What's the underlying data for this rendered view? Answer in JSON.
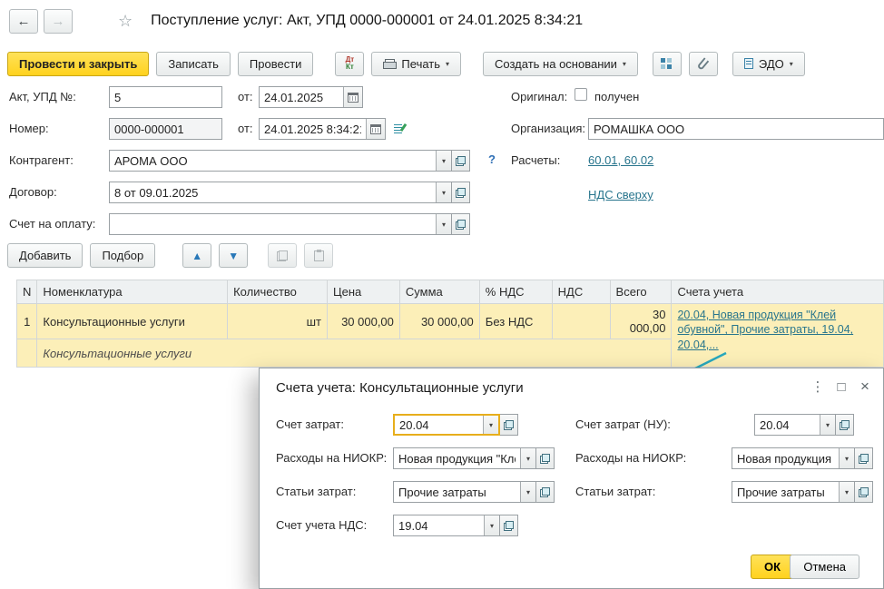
{
  "icons": {
    "back": "←",
    "forward": "→",
    "star": "☆",
    "caret": "▾",
    "up": "▲",
    "down": "▼",
    "menu": "⋮",
    "maximize": "□",
    "close": "×"
  },
  "colors": {
    "accent_yellow": "#ffd21e",
    "link_teal": "#28758d",
    "row_highlight": "#fcefb8",
    "focus_border": "#e7ae1c",
    "callout_arrow": "#29a8bd"
  },
  "titlebar": {
    "title": "Поступление услуг: Акт, УПД 0000-000001 от 24.01.2025 8:34:21"
  },
  "toolbar": {
    "post_and_close": "Провести и закрыть",
    "write": "Записать",
    "post": "Провести",
    "dtkt_dt": "Дт",
    "dtkt_kt": "Кт",
    "print": "Печать",
    "create_on_basis": "Создать на основании",
    "edo": "ЭДО"
  },
  "form": {
    "left": {
      "act_label": "Акт, УПД №:",
      "act_number": "5",
      "act_from_label": "от:",
      "act_date": "24.01.2025",
      "number_label": "Номер:",
      "number_value": "0000-000001",
      "number_from_label": "от:",
      "number_datetime": "24.01.2025 8:34:21",
      "counterparty_label": "Контрагент:",
      "counterparty_value": "АРОМА ООО",
      "help_link": "?",
      "contract_label": "Договор:",
      "contract_value": "8 от 09.01.2025",
      "invoice_label": "Счет на оплату:",
      "invoice_value": ""
    },
    "right": {
      "original_label": "Оригинал:",
      "original_checkbox_label": "получен",
      "organization_label": "Организация:",
      "organization_value": "РОМАШКА ООО",
      "settlements_label": "Расчеты:",
      "settlements_link": "60.01, 60.02",
      "vat_link": "НДС сверху"
    }
  },
  "table_toolbar": {
    "add": "Добавить",
    "pick": "Подбор"
  },
  "table": {
    "headers": [
      "N",
      "Номенклатура",
      "Количество",
      "Цена",
      "Сумма",
      "% НДС",
      "НДС",
      "Всего",
      "Счета учета"
    ],
    "row": {
      "n": "1",
      "nomenclature": "Консультационные услуги",
      "unit": "шт",
      "price": "30 000,00",
      "amount": "30 000,00",
      "vat_rate": "Без НДС",
      "vat": "",
      "total": "30 000,00",
      "accounts_link": "20.04, Новая продукция \"Клей обувной\", Прочие затраты, 19.04, 20.04,...",
      "content": "Консультационные услуги"
    }
  },
  "dialog": {
    "title": "Счета учета: Консультационные услуги",
    "fields": {
      "cost_account_label": "Счет затрат:",
      "cost_account_value": "20.04",
      "cost_account_nu_label": "Счет затрат (НУ):",
      "cost_account_nu_value": "20.04",
      "rnd_left_label": "Расходы на НИОКР:",
      "rnd_left_value": "Новая продукция \"Кле",
      "rnd_right_label": "Расходы на НИОКР:",
      "rnd_right_value": "Новая продукция \"Кле",
      "cost_item_left_label": "Статьи затрат:",
      "cost_item_left_value": "Прочие затраты",
      "cost_item_right_label": "Статьи затрат:",
      "cost_item_right_value": "Прочие затраты",
      "vat_account_label": "Счет учета НДС:",
      "vat_account_value": "19.04"
    },
    "ok": "ОК",
    "cancel": "Отмена"
  }
}
